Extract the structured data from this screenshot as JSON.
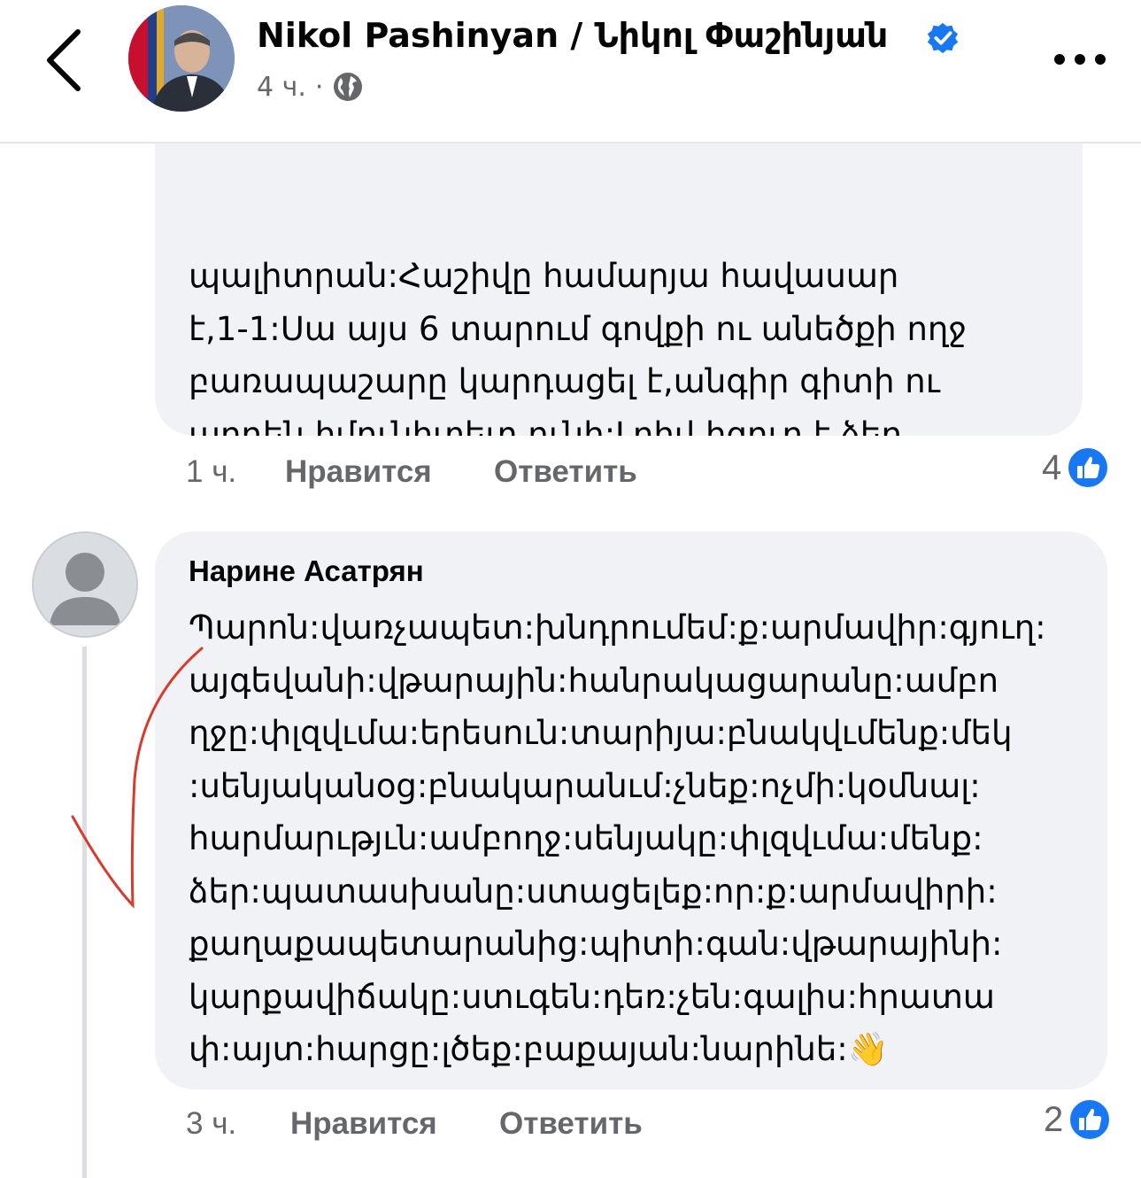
{
  "header": {
    "page_name": "Nikol Pashinyan / Նիկոլ Փաշինյան",
    "time": "4 ч.",
    "separator": "·",
    "icons": {
      "back": "chevron-left-icon",
      "verified": "verified-badge-icon",
      "privacy": "globe-icon",
      "more": "more-dots-icon"
    },
    "accent": "#1877f2"
  },
  "comments": [
    {
      "text": "պալիտրան:Հաշիվը համարյա հավասար\nէ,1-1:Սա այս 6 տարում գովքի ու անեծքի ողջ\nբառապաշարը կարդացել է,անգիր գիտի ու\nարդեն իմունիտետ ունի:Լրիվ իզուր է ձեր\nգրածը,սուրճ խմեք ու կիրակի վայելեք:)))",
      "time": "1 ч.",
      "like_label": "Нравится",
      "reply_label": "Ответить",
      "reaction_count": "4"
    },
    {
      "author": "Нарине Асатрян",
      "text": "Պարոն:վառչապետ:խնդրումեմ:ք:արմավիր:գյուղ:\nայգեվանի:վթարային:հանրակացարանը:ամբո\nղջը:փլզվւմա:երեսուն:տարիյա:բնակվւմենք:մեկ\n:սենյականօց:բնակարանւմ:չնեք:ոչմի:կօմնալ:\nհարմարւթյւն:ամբողջ:սենյակը:փլզվւմա:մենք:\nձեր:պատասխանը:ստացելեք:որ:ք:արմավիրի:\nքաղաքապետարանից:պիտի:գան:վթարայինի:\nկարքավիճակը:ստւգեն:դեռ:չեն:գալիս:հրատա\nփ:այտ:հարցը:լծեք:բաքայան:նարինե:👋",
      "time": "3 ч.",
      "like_label": "Нравится",
      "reply_label": "Ответить",
      "reaction_count": "2"
    }
  ]
}
